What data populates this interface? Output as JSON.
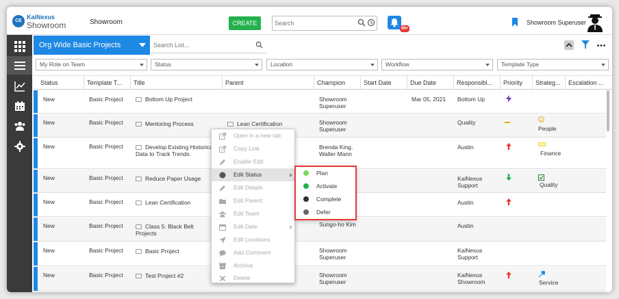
{
  "header": {
    "logo_badge": "CE",
    "logo_top": "KaiNexus",
    "logo_bottom": "Showroom",
    "site_name": "Showroom",
    "create_label": "CREATE",
    "search_placeholder": "Search",
    "notification_badge": "99+",
    "user_name": "Showroom Superuser"
  },
  "list": {
    "title": "Org Wide Basic Projects",
    "search_placeholder": "Search List..."
  },
  "filters": [
    {
      "label": "My Role on Team"
    },
    {
      "label": "Status"
    },
    {
      "label": "Location"
    },
    {
      "label": "Workflow"
    },
    {
      "label": "Template Type"
    }
  ],
  "columns": [
    "Status",
    "Template T...",
    "Title",
    "Parent",
    "Champion",
    "Start Date",
    "Due Date",
    "Responsibl...",
    "Priority",
    "Strateg...",
    "Escalation ..."
  ],
  "rows": [
    {
      "status": "New",
      "template": "Basic Project",
      "title": "Bottom Up Project",
      "parent": "",
      "champion": "Showroom Superuser",
      "due": "Mar 05, 2021",
      "responsible": "Bottom Up",
      "priority": "bolt",
      "strategy": ""
    },
    {
      "status": "New",
      "template": "Basic Project",
      "title": "Mentoring Process",
      "parent": "Lean Certification",
      "champion": "Showroom Superuser",
      "due": "",
      "responsible": "Quality",
      "priority": "dash",
      "strategy": "People"
    },
    {
      "status": "New",
      "template": "Basic Project",
      "title": "Develop Existing Historical Data to Track Trends",
      "parent": "",
      "champion": "Brenda King, Walter Mann",
      "due": "",
      "responsible": "Austin",
      "priority": "up",
      "strategy": "Finance"
    },
    {
      "status": "New",
      "template": "Basic Project",
      "title": "Reduce Paper Usage",
      "parent": "",
      "champion": "",
      "due": "",
      "responsible": "KaiNexus Support",
      "priority": "down",
      "strategy": "Quality"
    },
    {
      "status": "New",
      "template": "Basic Project",
      "title": "Lean Certification",
      "parent": "",
      "champion": "",
      "due": "",
      "responsible": "Austin",
      "priority": "up",
      "strategy": ""
    },
    {
      "status": "New",
      "template": "Basic Project",
      "title": "Class 5: Black Belt Projects",
      "parent": "",
      "champion": "Sungo-ho Kim",
      "due": "",
      "responsible": "Austin",
      "priority": "",
      "strategy": ""
    },
    {
      "status": "New",
      "template": "Basic Project",
      "title": "Basic Project",
      "parent": "",
      "champion": "Showroom Superuser",
      "due": "",
      "responsible": "KaiNexus Support",
      "priority": "",
      "strategy": ""
    },
    {
      "status": "New",
      "template": "Basic Project",
      "title": "Test Project #2",
      "parent": "",
      "champion": "Showroom Superuser",
      "due": "",
      "responsible": "KaiNexus Showroom",
      "priority": "up",
      "strategy": "Service"
    }
  ],
  "context_menu": [
    {
      "label": "Open in a new tab",
      "icon": "external-link-icon"
    },
    {
      "label": "Copy Link",
      "icon": "share-icon"
    },
    {
      "label": "Enable Edit",
      "icon": "pencil-icon"
    },
    {
      "label": "Edit Status",
      "icon": "status-circle-icon"
    },
    {
      "label": "Edit Details",
      "icon": "pencil-icon"
    },
    {
      "label": "Edit Parent",
      "icon": "folder-icon"
    },
    {
      "label": "Edit Team",
      "icon": "team-icon"
    },
    {
      "label": "Edit Date",
      "icon": "calendar-icon"
    },
    {
      "label": "Edit Locations",
      "icon": "location-arrow-icon"
    },
    {
      "label": "Add Comment",
      "icon": "comment-icon"
    },
    {
      "label": "Archive",
      "icon": "archive-icon"
    },
    {
      "label": "Delete",
      "icon": "x-icon"
    }
  ],
  "status_menu": [
    {
      "label": "Plan",
      "color": "#7ed957"
    },
    {
      "label": "Activate",
      "color": "#22b14c"
    },
    {
      "label": "Complete",
      "color": "#333333"
    },
    {
      "label": "Defer",
      "color": "#666666"
    }
  ],
  "colors": {
    "accent": "#1e88e5",
    "create": "#22b14c",
    "highlight": "#e53935"
  }
}
